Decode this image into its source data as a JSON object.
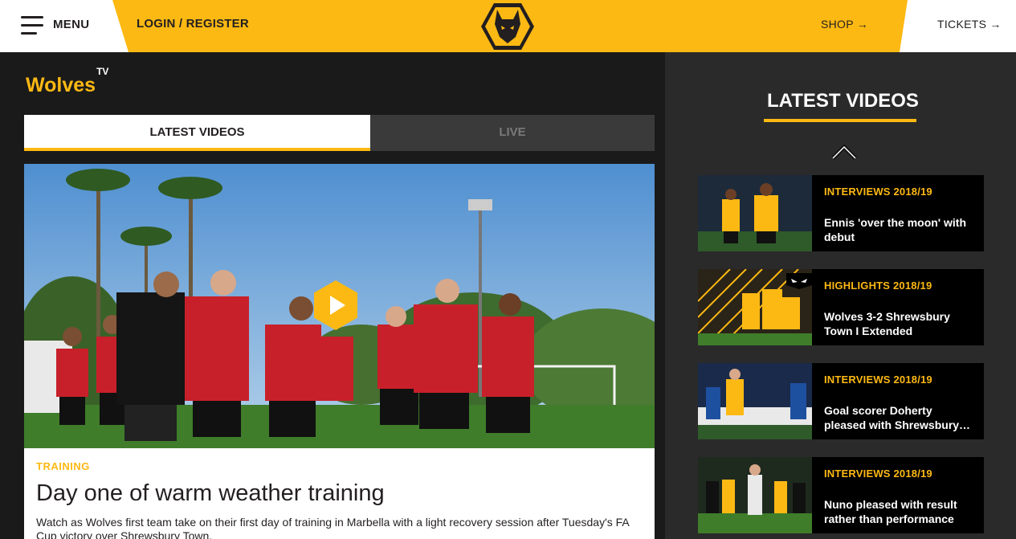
{
  "header": {
    "menu_label": "MENU",
    "login_label": "LOGIN / REGISTER",
    "shop_label": "SHOP →",
    "tickets_label": "TICKETS →",
    "brand_color": "#fdb913"
  },
  "main": {
    "brand": "Wolves",
    "brand_sup": "TV",
    "tabs": [
      {
        "label": "LATEST VIDEOS",
        "active": true
      },
      {
        "label": "LIVE",
        "active": false
      }
    ],
    "featured": {
      "category": "TRAINING",
      "title": "Day one of warm weather training",
      "description": "Watch as Wolves first team take on their first day of training in Marbella with a light recovery session after Tuesday's FA Cup victory over Shrewsbury Town."
    }
  },
  "sidebar": {
    "title": "LATEST VIDEOS",
    "videos": [
      {
        "category": "INTERVIEWS 2018/19",
        "title": "Ennis 'over the moon' with debut"
      },
      {
        "category": "HIGHLIGHTS 2018/19",
        "title": "Wolves 3-2 Shrewsbury Town I Extended"
      },
      {
        "category": "INTERVIEWS 2018/19",
        "title": "Goal scorer Doherty pleased with Shrewsbury…"
      },
      {
        "category": "INTERVIEWS 2018/19",
        "title": "Nuno pleased with result rather than performance"
      }
    ]
  }
}
